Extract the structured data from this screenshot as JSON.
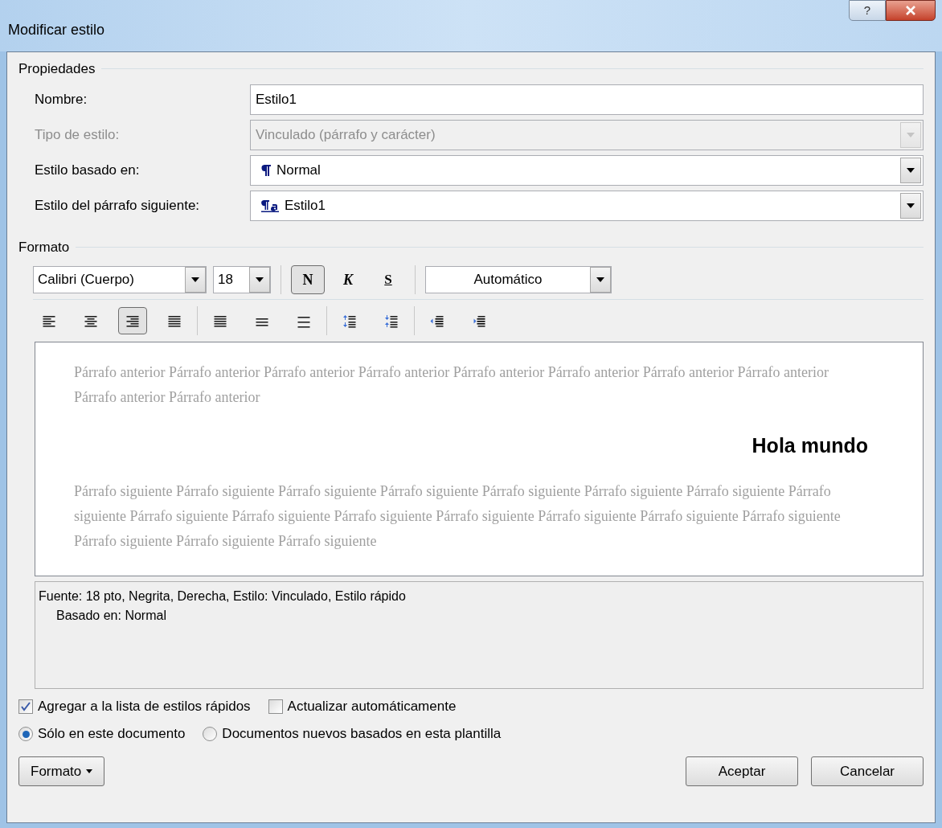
{
  "window": {
    "title": "Modificar estilo",
    "title_buttons": [
      {
        "kind": "help",
        "label": "?"
      },
      {
        "kind": "close"
      }
    ]
  },
  "properties": {
    "heading": "Propiedades",
    "fields": [
      {
        "label": "Nombre:",
        "kind": "text",
        "value": "Estilo1",
        "disabled": false
      },
      {
        "label": "Tipo de estilo:",
        "kind": "select",
        "value": "Vinculado (párrafo y carácter)",
        "disabled": true
      },
      {
        "label": "Estilo basado en:",
        "kind": "paragraph-style",
        "value": "Normal",
        "disabled": false
      },
      {
        "label": "Estilo del párrafo siguiente:",
        "kind": "linked-style",
        "value": "Estilo1",
        "disabled": false
      }
    ]
  },
  "format": {
    "heading": "Formato",
    "font": {
      "value": "Calibri (Cuerpo)"
    },
    "size": {
      "value": "18"
    },
    "styles": [
      {
        "kind": "bold",
        "label": "N",
        "selected": true
      },
      {
        "kind": "italic",
        "label": "K",
        "selected": false
      },
      {
        "kind": "underline",
        "label": "S",
        "selected": false
      }
    ],
    "color": {
      "value": "Automático"
    },
    "paragraph_groups": [
      {
        "buttons": [
          {
            "kind": "align-left",
            "selected": false
          },
          {
            "kind": "align-center",
            "selected": false
          },
          {
            "kind": "align-right",
            "selected": true
          },
          {
            "kind": "justify",
            "selected": false
          }
        ]
      },
      {
        "buttons": [
          {
            "kind": "spacing-single",
            "selected": false
          },
          {
            "kind": "spacing-half",
            "selected": false
          },
          {
            "kind": "spacing-double",
            "selected": false
          }
        ]
      },
      {
        "buttons": [
          {
            "kind": "space-increase",
            "selected": false
          },
          {
            "kind": "space-decrease",
            "selected": false
          }
        ]
      },
      {
        "buttons": [
          {
            "kind": "indent-decrease",
            "selected": false
          },
          {
            "kind": "indent-increase",
            "selected": false
          }
        ]
      }
    ]
  },
  "preview": {
    "previous": "Párrafo anterior Párrafo anterior Párrafo anterior Párrafo anterior Párrafo anterior Párrafo anterior Párrafo anterior Párrafo anterior Párrafo anterior Párrafo anterior",
    "sample": "Hola mundo",
    "following": "Párrafo siguiente Párrafo siguiente Párrafo siguiente Párrafo siguiente Párrafo siguiente Párrafo siguiente Párrafo siguiente Párrafo siguiente Párrafo siguiente Párrafo siguiente Párrafo siguiente Párrafo siguiente Párrafo siguiente Párrafo siguiente Párrafo siguiente Párrafo siguiente Párrafo siguiente Párrafo siguiente"
  },
  "description": [
    "Fuente: 18 pto, Negrita, Derecha, Estilo: Vinculado, Estilo rápido",
    "Basado en: Normal"
  ],
  "checkboxes": [
    {
      "label": "Agregar a la lista de estilos rápidos",
      "checked": true
    },
    {
      "label": "Actualizar automáticamente",
      "checked": false
    }
  ],
  "radios": [
    {
      "label": "Sólo en este documento",
      "selected": true
    },
    {
      "label": "Documentos nuevos basados en esta plantilla",
      "selected": false
    }
  ],
  "format_button": {
    "label": "Formato"
  },
  "buttons": [
    {
      "label": "Aceptar"
    },
    {
      "label": "Cancelar"
    }
  ]
}
